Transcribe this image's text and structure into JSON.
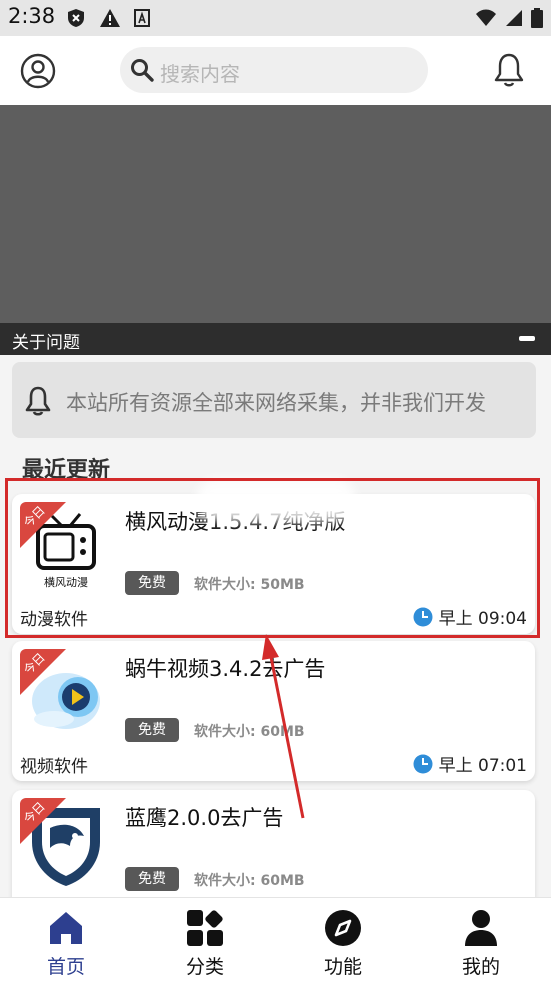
{
  "status_bar": {
    "time": "2:38",
    "icons": [
      "shield-x-icon",
      "warning-icon",
      "text-a-icon",
      "wifi-icon",
      "signal-icon",
      "battery-icon"
    ]
  },
  "header": {
    "search_placeholder": "搜索内容",
    "profile_icon": "user-circle-icon",
    "bell_icon": "bell-icon"
  },
  "notice": {
    "title": "关于问题",
    "text": "本站所有资源全部来网络采集，并非我们开发"
  },
  "section": {
    "title": "最近更新"
  },
  "ribbon_text": "今日",
  "apps": [
    {
      "name": "横风动漫1.5.4.7纯净版",
      "badge": "免费",
      "size": "软件大小: 50MB",
      "category": "动漫软件",
      "time": "早上 09:04"
    },
    {
      "name": "蜗牛视频3.4.2去广告",
      "badge": "免费",
      "size": "软件大小: 60MB",
      "category": "视频软件",
      "time": "早上 07:01"
    },
    {
      "name": "蓝鹰2.0.0去广告",
      "badge": "免费",
      "size": "软件大小: 60MB",
      "category": "",
      "time": ""
    }
  ],
  "app_logo_text": "横风动漫",
  "nav": [
    {
      "label": "首页",
      "icon": "home-icon",
      "active": true
    },
    {
      "label": "分类",
      "icon": "category-grid-icon",
      "active": false
    },
    {
      "label": "功能",
      "icon": "compass-icon",
      "active": false
    },
    {
      "label": "我的",
      "icon": "user-icon",
      "active": false
    }
  ],
  "colors": {
    "nav_active": "#2d3f8f",
    "ribbon": "#d9473f",
    "annotation": "#d32a2a",
    "clock": "#2f8dd8"
  }
}
